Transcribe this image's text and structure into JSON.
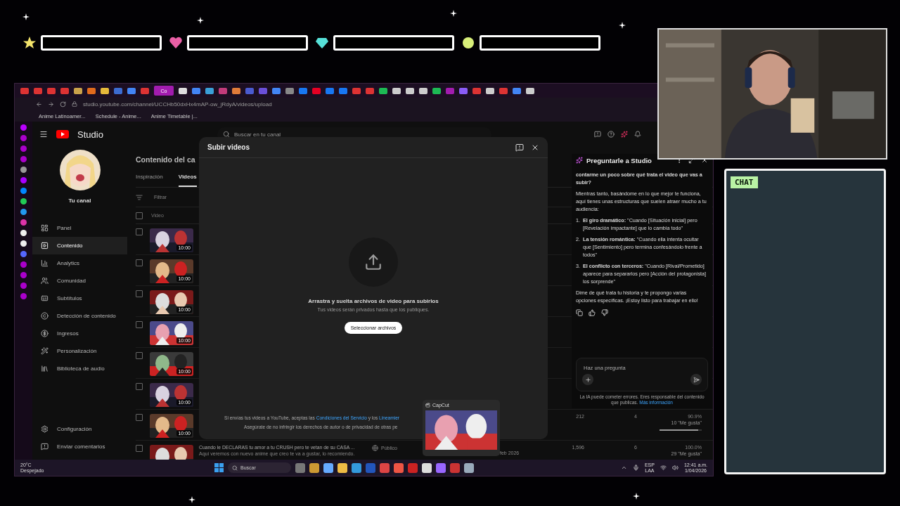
{
  "overlay_bars": [
    {
      "kind": "star",
      "color": "#f3e36b"
    },
    {
      "kind": "heart",
      "color": "#ea5fa6"
    },
    {
      "kind": "diamond",
      "color": "#56e0d8"
    },
    {
      "kind": "circle",
      "color": "#d9f07a"
    }
  ],
  "chat_panel": {
    "label": "CHAT"
  },
  "browser": {
    "tabs": [
      {
        "selected": false
      },
      {
        "selected": false
      },
      {
        "selected": false
      },
      {
        "selected": false
      },
      {
        "selected": false
      },
      {
        "selected": false
      },
      {
        "selected": false
      },
      {
        "selected": false
      },
      {
        "selected": false
      },
      {
        "selected": false
      },
      {
        "selected": true,
        "label": "Co"
      },
      {
        "selected": false
      },
      {
        "selected": false
      },
      {
        "selected": false
      },
      {
        "selected": false
      },
      {
        "selected": false
      },
      {
        "selected": false
      },
      {
        "selected": false
      },
      {
        "selected": false
      },
      {
        "selected": false
      },
      {
        "selected": false
      },
      {
        "selected": false
      },
      {
        "selected": false
      },
      {
        "selected": false
      },
      {
        "selected": false
      },
      {
        "selected": false
      },
      {
        "selected": false
      },
      {
        "selected": false
      },
      {
        "selected": false
      },
      {
        "selected": false
      },
      {
        "selected": false
      },
      {
        "selected": false
      },
      {
        "selected": false
      },
      {
        "selected": false
      },
      {
        "selected": false
      },
      {
        "selected": false
      },
      {
        "selected": false
      },
      {
        "selected": false
      }
    ],
    "address": "studio.youtube.com/channel/UCCHb50dxHx4mAP-ow_jRdyA/videos/upload",
    "bookmarks": [
      "Anime Latinoamer...",
      "Schedule - Anime...",
      "Anime Timetable |..."
    ]
  },
  "studio": {
    "logo": "Studio",
    "search_placeholder": "Buscar en tu canal",
    "channel": {
      "name": "Tu canal"
    },
    "nav": [
      {
        "label": "Panel",
        "selected": false,
        "kind": "panel"
      },
      {
        "label": "Contenido",
        "selected": true,
        "kind": "content"
      },
      {
        "label": "Analytics",
        "selected": false,
        "kind": "analytics"
      },
      {
        "label": "Comunidad",
        "selected": false,
        "kind": "community"
      },
      {
        "label": "Subtítulos",
        "selected": false,
        "kind": "subtitles"
      },
      {
        "label": "Detección de contenido",
        "selected": false,
        "kind": "copyright"
      },
      {
        "label": "Ingresos",
        "selected": false,
        "kind": "money"
      },
      {
        "label": "Personalización",
        "selected": false,
        "kind": "wand"
      },
      {
        "label": "Biblioteca de audio",
        "selected": false,
        "kind": "library"
      }
    ],
    "nav_bottom": [
      {
        "label": "Configuración",
        "kind": "settings"
      },
      {
        "label": "Enviar comentarios",
        "kind": "feedback"
      }
    ],
    "content": {
      "heading": "Contenido del ca",
      "tabs": [
        {
          "label": "Inspiración",
          "selected": false
        },
        {
          "label": "Videos",
          "selected": true
        }
      ],
      "filter_placeholder": "Filtrar",
      "column_header": "Video",
      "header_checked": false,
      "rows": [
        {
          "duration": "10:00",
          "checked": false
        },
        {
          "duration": "10:00",
          "checked": false
        },
        {
          "duration": "10:00",
          "checked": false
        },
        {
          "duration": "10:00",
          "checked": false
        },
        {
          "duration": "10:00",
          "checked": false
        },
        {
          "duration": "10:00",
          "checked": false
        },
        {
          "duration": "10:00",
          "checked": false,
          "views": "212",
          "comments": "4",
          "likes": "90.9%",
          "likes_note": "10 \"Me gusta\"",
          "level": 0.909
        },
        {
          "checked": false,
          "title": "Cuando le DECLARAS tu amor a tu CRUSH pero te vetan de su CASA ...",
          "description": "Aquí veremos con nuevo anime que creo te va a gustar, lo recomiendo.",
          "visibility": "Público",
          "date": "feb 2026",
          "views": "1,596",
          "comments": "6",
          "likes": "100.0%",
          "likes_note": "29 \"Me gusta\""
        }
      ]
    },
    "upload_dialog": {
      "title": "Subir videos",
      "heading": "Arrastra y suelta archivos de video para subirlos",
      "subtext": "Tus videos serán privados hasta que los publiques.",
      "button": "Seleccionar archivos",
      "terms_lead": "Si envías tus videos a YouTube, aceptas las",
      "terms_link": "Condiciones del Servicio",
      "terms_mid": "y los",
      "terms_link_2": "Lineamier",
      "terms_line_2": "Asegúrate de no infringir los derechos de autor o de privacidad de otras pe"
    },
    "assistant": {
      "title": "Preguntarle a Studio",
      "question": "contarme un poco sobre qué trata el video que vas a subir?",
      "intro": "Mientras tanto, basándome en lo que mejor te funciona, aquí tienes unas estructuras que suelen atraer mucho a tu audiencia:",
      "items": [
        {
          "number": "1.",
          "text": "**El giro dramático:** \"Cuando [Situación inicial] pero [Revelación impactante] que lo cambia todo\""
        },
        {
          "number": "2.",
          "text": "**La tensión romántica:** \"Cuando ella intenta ocultar que [Sentimiento] pero termina confesándolo frente a todos\""
        },
        {
          "number": "3.",
          "text": "**El conflicto con terceros:** \"Cuando [Rival/Prometido] aparece para separarlos pero [Acción del protagonista] los sorprende\""
        }
      ],
      "closing": "Dime de qué trata tu historia y te propongo varias opciones específicas. ¡Estoy listo para trabajar en ello!",
      "input_placeholder": "Haz una pregunta",
      "disclaimer": "La IA puede cometer errores. Eres responsable del contenido que publicas.",
      "disclaimer_link": "Más información"
    }
  },
  "capcut_preview": {
    "title": "CapCut"
  },
  "taskbar": {
    "temperature": "20°C",
    "weather": "Despejado",
    "search": "Buscar",
    "language": "ESP",
    "layout": "LAA",
    "time": "12:41 a.m.",
    "date": "1/04/2026"
  }
}
